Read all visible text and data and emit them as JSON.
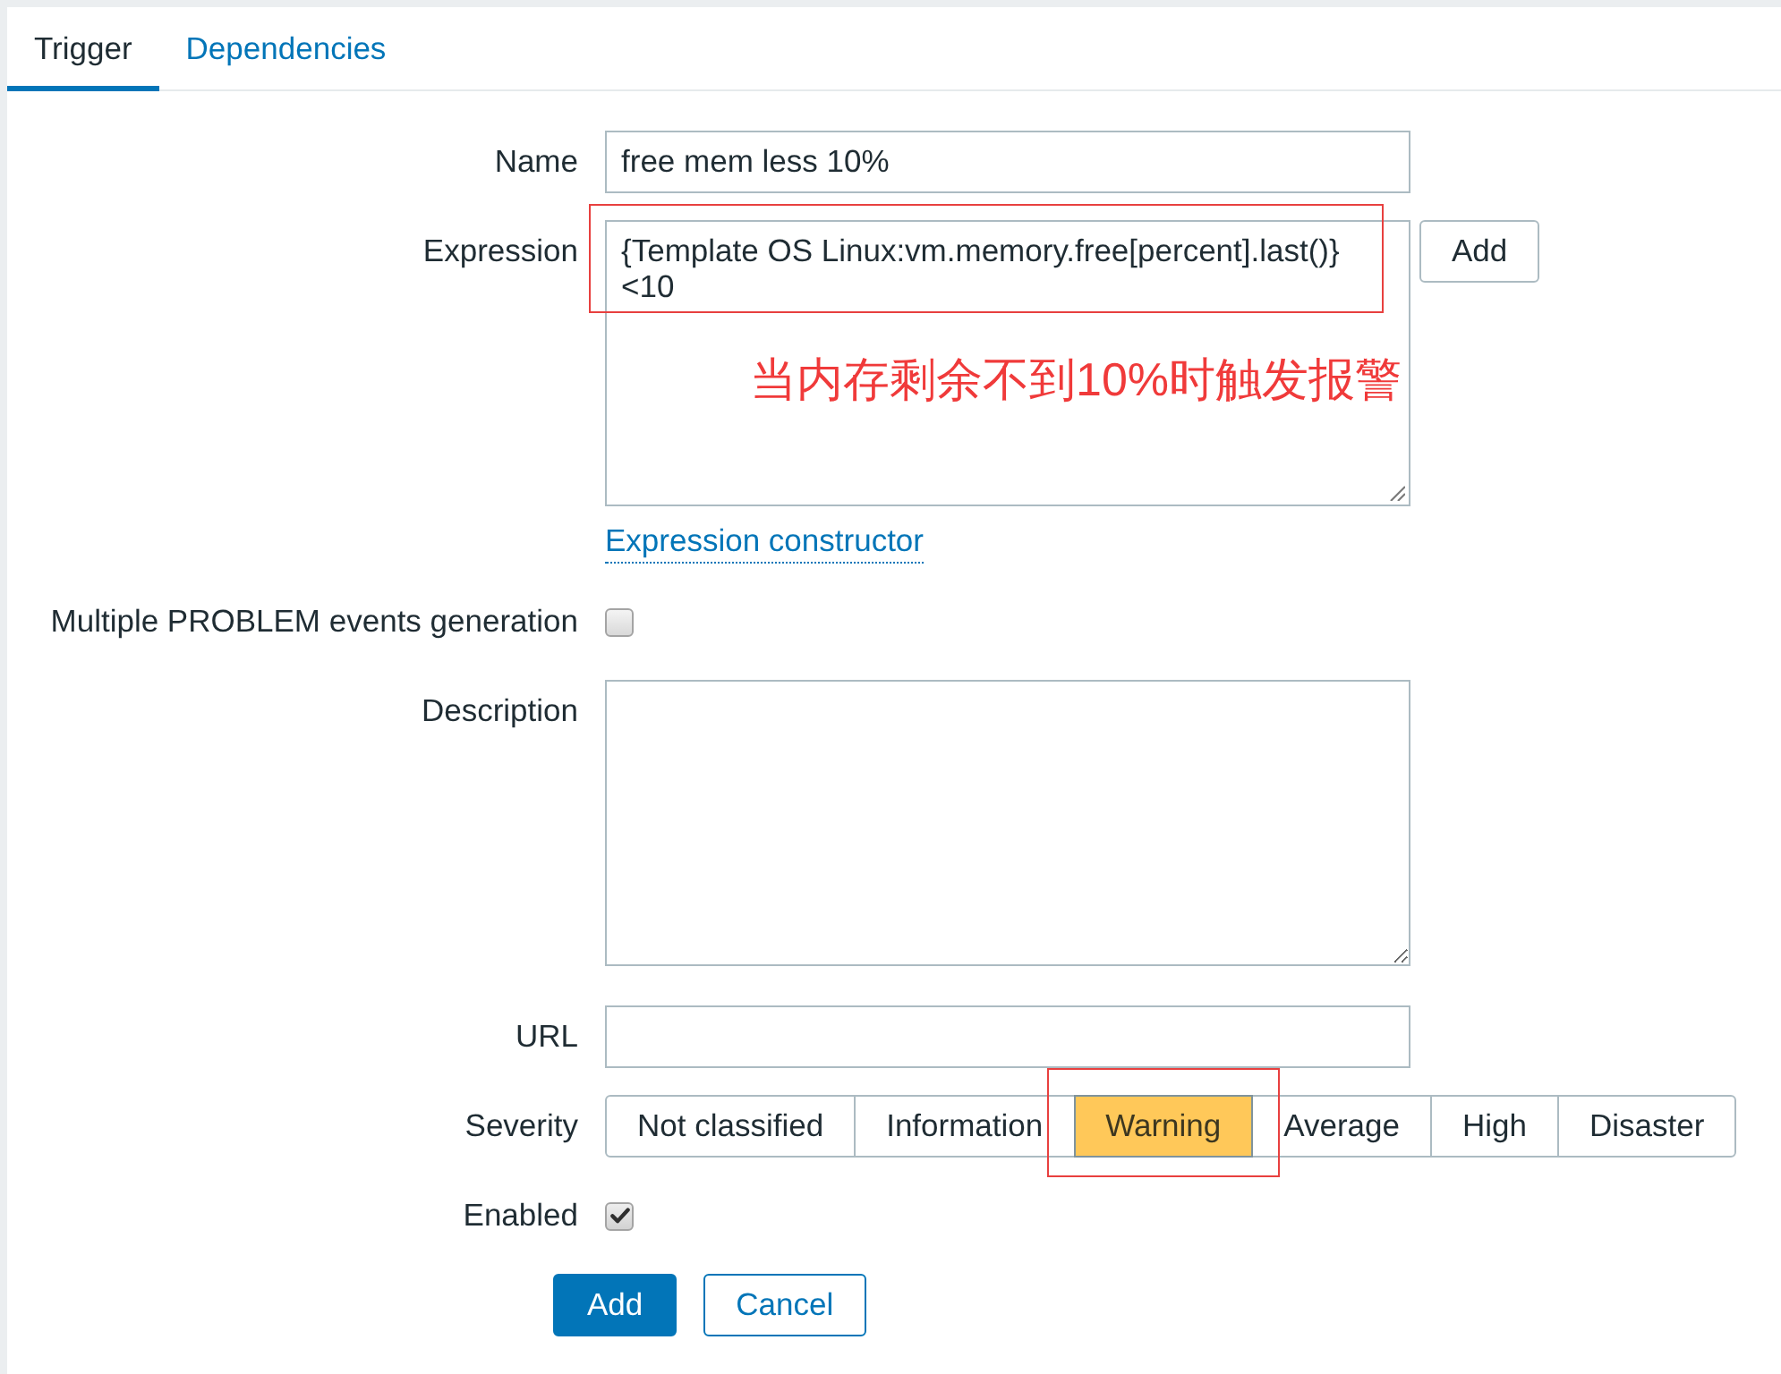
{
  "tabs": [
    {
      "label": "Trigger",
      "selected": true
    },
    {
      "label": "Dependencies",
      "selected": false
    }
  ],
  "fields": [
    {
      "kind": "text",
      "label": "Name",
      "value": "free mem less 10%"
    },
    {
      "kind": "expression",
      "label": "Expression",
      "value": "{Template OS Linux:vm.memory.free[percent].last()}\n<10",
      "highlighted": true,
      "note": "当内存剩余不到10%时触发报警",
      "button": "Add",
      "link": "Expression constructor"
    },
    {
      "kind": "checkbox",
      "label": "Multiple PROBLEM events generation",
      "checked": false
    },
    {
      "kind": "textarea",
      "label": "Description"
    },
    {
      "kind": "text",
      "label": "URL"
    },
    {
      "kind": "segmented",
      "label": "Severity",
      "options": [
        {
          "label": "Not classified",
          "selected": false,
          "highlighted": false
        },
        {
          "label": "Information",
          "selected": false,
          "highlighted": false
        },
        {
          "label": "Warning",
          "selected": true,
          "highlighted": true
        },
        {
          "label": "Average",
          "selected": false,
          "highlighted": false
        },
        {
          "label": "High",
          "selected": false,
          "highlighted": false
        },
        {
          "label": "Disaster",
          "selected": false,
          "highlighted": false
        }
      ]
    },
    {
      "kind": "checkbox",
      "label": "Enabled",
      "checked": true
    }
  ],
  "buttons": [
    {
      "label": "Add",
      "kind": "primary"
    },
    {
      "label": "Cancel",
      "kind": "secondary"
    }
  ]
}
